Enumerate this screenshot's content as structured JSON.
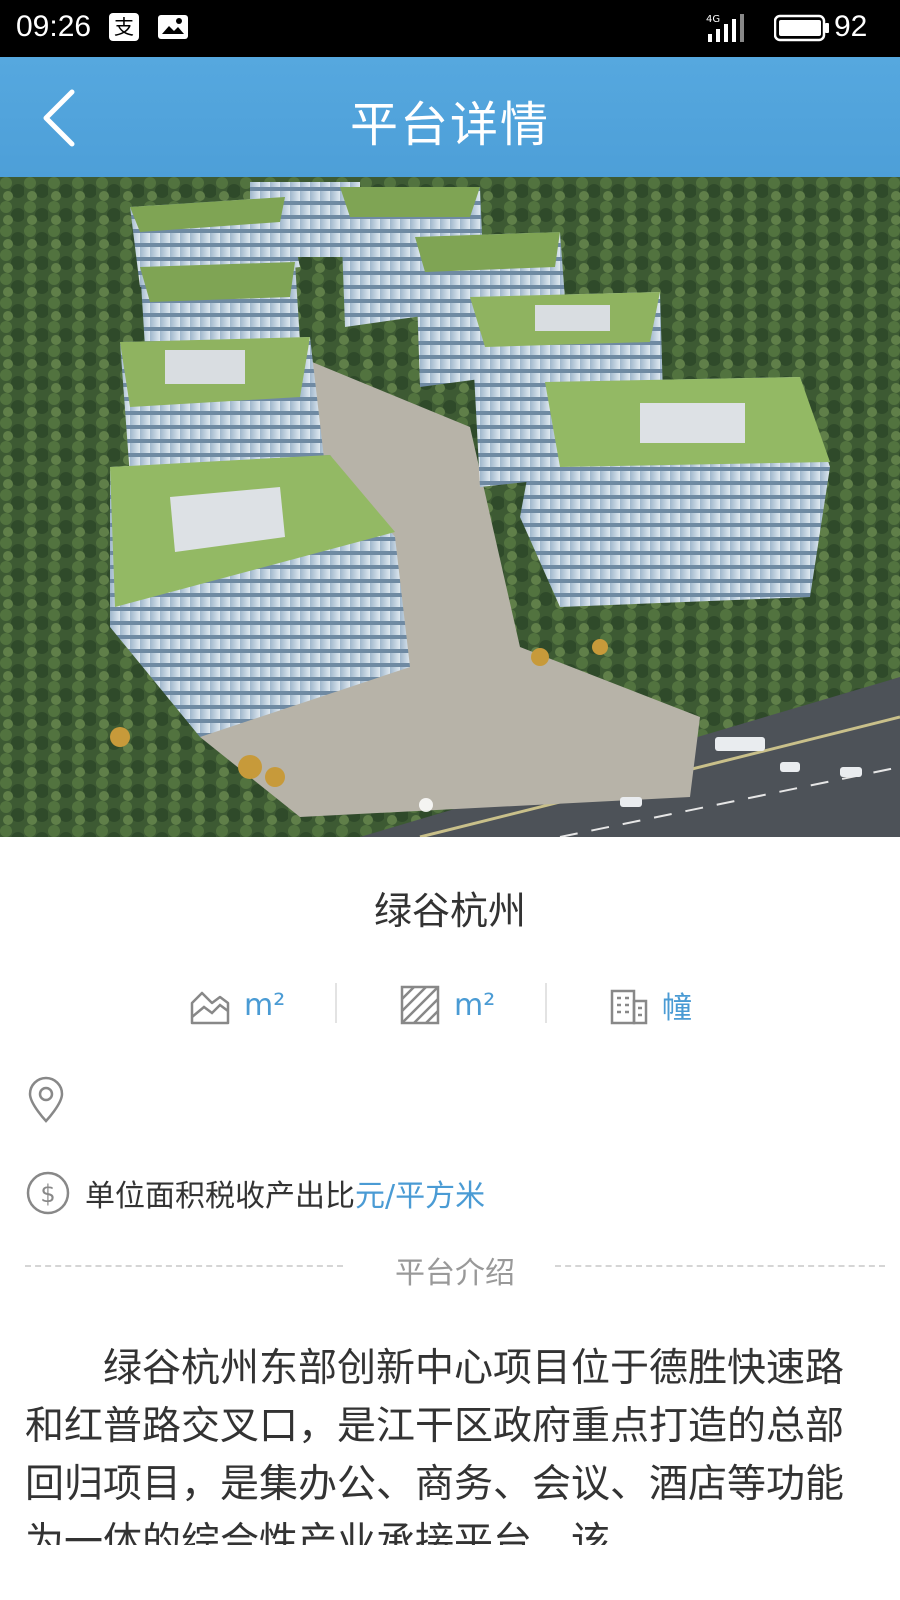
{
  "status_bar": {
    "time": "09:26",
    "network": "4G",
    "battery": "92"
  },
  "nav": {
    "title": "平台详情",
    "back_icon": "chevron-left-icon"
  },
  "banner": {
    "slide_count": 1,
    "active_slide": 1
  },
  "platform": {
    "name": "绿谷杭州",
    "stats": [
      {
        "icon": "land-area-icon",
        "unit": "m²"
      },
      {
        "icon": "building-area-icon",
        "unit": "m²"
      },
      {
        "icon": "building-count-icon",
        "unit": "幢"
      }
    ],
    "address": "",
    "tax_label": "单位面积税收产出比",
    "tax_unit": "元/平方米"
  },
  "intro": {
    "section_label": "平台介绍",
    "text": "绿谷杭州东部创新中心项目位于德胜快速路和红普路交叉口，是江干区政府重点打造的总部回归项目，是集办公、商务、会议、酒店等功能为一体的综合性产业承接平台，该"
  },
  "colors": {
    "accent": "#4a9bd4",
    "nav_bg": "#52a4dc"
  }
}
